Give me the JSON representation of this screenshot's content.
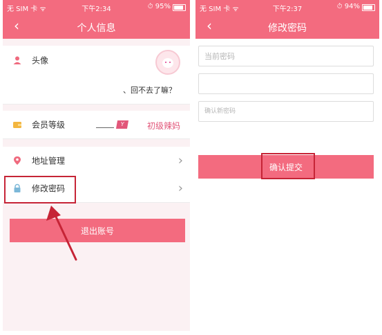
{
  "left": {
    "status": {
      "carrier": "无 SIM 卡 ᯤ",
      "time": "下午2:34",
      "battery": "⏱ 95%"
    },
    "nav": {
      "back": "‹",
      "title": "个人信息"
    },
    "rows": {
      "avatar_label": "头像",
      "comment": "、回不去了嘛？",
      "level_label": "会员等级",
      "level_badge": "Y",
      "level_value": "初级辣妈",
      "address_label": "地址管理",
      "password_label": "修改密码",
      "chevron": "›"
    },
    "logout": "退出账号"
  },
  "right": {
    "status": {
      "carrier": "无 SIM 卡 ᯤ",
      "time": "下午2:37",
      "battery": "⏱ 94%"
    },
    "nav": {
      "back": "‹",
      "title": "修改密码"
    },
    "fields": {
      "current_placeholder": "当前密码",
      "new_placeholder": "",
      "confirm_placeholder": "确认新密码"
    },
    "submit": "确认提交"
  },
  "colors": {
    "accent": "#f36b7f",
    "highlight": "#c62436",
    "badge": "#e2577a"
  }
}
